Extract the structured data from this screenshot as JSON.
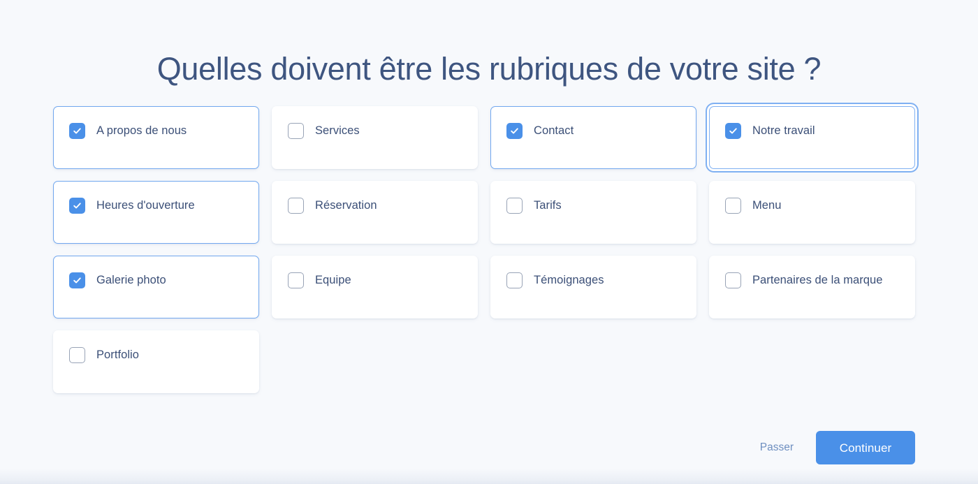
{
  "page": {
    "title": "Quelles doivent être les rubriques de votre site ?",
    "background_color": "#f7f9fc",
    "title_color": "#3e5580",
    "accent_color": "#4a90e8",
    "checked_border_color": "#72a8ef"
  },
  "options": [
    {
      "label": "A propos de nous",
      "checked": true,
      "focused": false,
      "icon": "checkbox-checked-icon"
    },
    {
      "label": "Services",
      "checked": false,
      "focused": false,
      "icon": "checkbox-unchecked-icon"
    },
    {
      "label": "Contact",
      "checked": true,
      "focused": false,
      "icon": "checkbox-checked-icon"
    },
    {
      "label": "Notre travail",
      "checked": true,
      "focused": true,
      "icon": "checkbox-checked-icon"
    },
    {
      "label": "Heures d'ouverture",
      "checked": true,
      "focused": false,
      "icon": "checkbox-checked-icon"
    },
    {
      "label": "Réservation",
      "checked": false,
      "focused": false,
      "icon": "checkbox-unchecked-icon"
    },
    {
      "label": "Tarifs",
      "checked": false,
      "focused": false,
      "icon": "checkbox-unchecked-icon"
    },
    {
      "label": "Menu",
      "checked": false,
      "focused": false,
      "icon": "checkbox-unchecked-icon"
    },
    {
      "label": "Galerie photo",
      "checked": true,
      "focused": false,
      "icon": "checkbox-checked-icon"
    },
    {
      "label": "Equipe",
      "checked": false,
      "focused": false,
      "icon": "checkbox-unchecked-icon"
    },
    {
      "label": "Témoignages",
      "checked": false,
      "focused": false,
      "icon": "checkbox-unchecked-icon"
    },
    {
      "label": "Partenaires de la marque",
      "checked": false,
      "focused": false,
      "icon": "checkbox-unchecked-icon"
    },
    {
      "label": "Portfolio",
      "checked": false,
      "focused": false,
      "icon": "checkbox-unchecked-icon"
    }
  ],
  "footer": {
    "skip_label": "Passer",
    "continue_label": "Continuer"
  }
}
